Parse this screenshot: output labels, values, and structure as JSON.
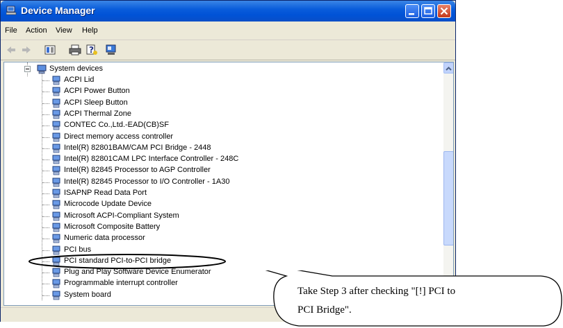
{
  "window": {
    "title": "Device Manager"
  },
  "menu": [
    "File",
    "Action",
    "View",
    "Help"
  ],
  "toolbar": [
    "back-icon",
    "forward-icon",
    "properties-icon",
    "print-icon",
    "help-icon",
    "scan-hardware-icon"
  ],
  "tree": {
    "category": "System devices",
    "items": [
      "ACPI Lid",
      "ACPI Power Button",
      "ACPI Sleep Button",
      "ACPI Thermal Zone",
      "CONTEC Co.,Ltd.-EAD(CB)SF",
      "Direct memory access controller",
      "Intel(R) 82801BAM/CAM PCI Bridge - 2448",
      "Intel(R) 82801CAM LPC Interface Controller - 248C",
      "Intel(R) 82845 Processor to AGP Controller",
      "Intel(R) 82845 Processor to I/O Controller - 1A30",
      "ISAPNP Read Data Port",
      "Microcode Update Device",
      "Microsoft ACPI-Compliant System",
      "Microsoft Composite Battery",
      "Numeric data processor",
      "PCI bus",
      "PCI standard PCI-to-PCI bridge",
      "Plug and Play Software Device Enumerator",
      "Programmable interrupt controller",
      "System board"
    ]
  },
  "callout": {
    "line1": "Take Step 3 after checking \"[!] PCI to",
    "line2": "PCI Bridge\"."
  }
}
